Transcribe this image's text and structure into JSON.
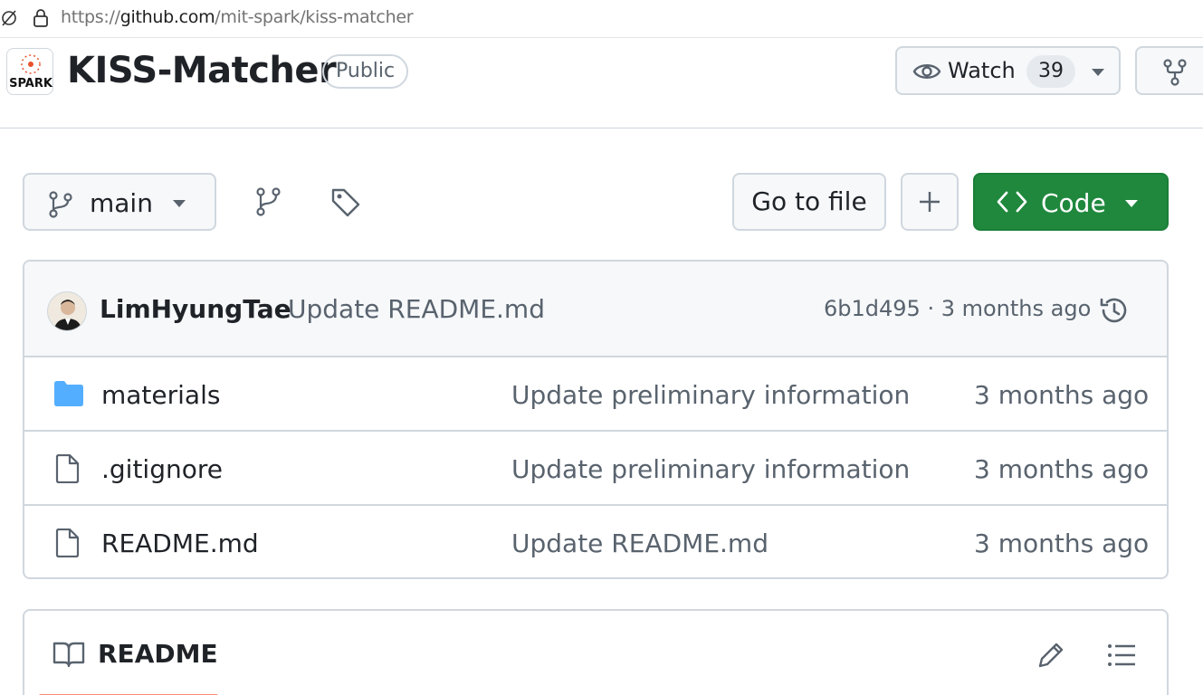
{
  "browser": {
    "url_scheme": "https://",
    "url_host": "github.com",
    "url_path": "/mit-spark/kiss-matcher",
    "icons": [
      "not-secure-icon",
      "lock-icon"
    ]
  },
  "repo": {
    "name": "KISS-Matcher",
    "visibility": "Public",
    "org_logo_text": "SPARK",
    "watch_label": "Watch",
    "watch_count": "39"
  },
  "toolbar": {
    "branch": "main",
    "go_to_file": "Go to file",
    "code_label": "Code"
  },
  "latest_commit": {
    "author": "LimHyungTae",
    "message": "Update README.md",
    "sha_and_time": "6b1d495 · 3 months ago"
  },
  "files": [
    {
      "type": "folder",
      "name": "materials",
      "message": "Update preliminary information",
      "date": "3 months ago"
    },
    {
      "type": "file",
      "name": ".gitignore",
      "message": "Update preliminary information",
      "date": "3 months ago"
    },
    {
      "type": "file",
      "name": "README.md",
      "message": "Update README.md",
      "date": "3 months ago"
    }
  ],
  "readme": {
    "title": "README"
  },
  "colors": {
    "accent_green": "#1f883d",
    "folder_blue": "#54aeff",
    "border": "#d0d7de",
    "muted_text": "#59636e",
    "tab_underline": "#fd8c73"
  }
}
